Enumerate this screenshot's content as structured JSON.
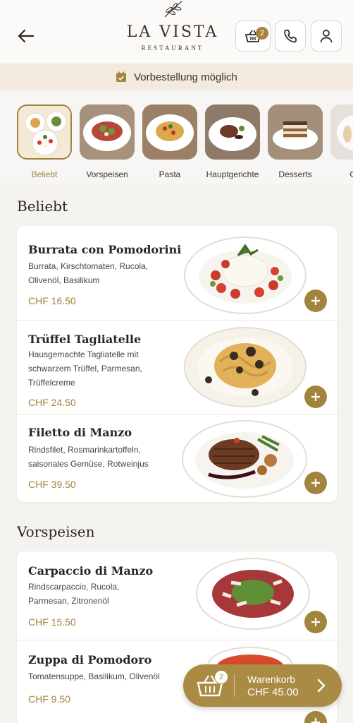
{
  "header": {
    "logo_title": "LA VISTA",
    "logo_subtitle": "RESTAURANT",
    "cart_count": "2"
  },
  "banner": {
    "text": "Vorbestellung möglich"
  },
  "categories": [
    {
      "label": "Beliebt",
      "active": true
    },
    {
      "label": "Vorspeisen"
    },
    {
      "label": "Pasta"
    },
    {
      "label": "Hauptgerichte"
    },
    {
      "label": "Desserts"
    },
    {
      "label": "Getr"
    }
  ],
  "sections": {
    "popular": {
      "title": "Beliebt",
      "items": [
        {
          "name": "Burrata con Pomodorini",
          "desc": "Burrata, Kirschtomaten, Rucola, Olivenöl, Basilikum",
          "price": "CHF 16.50"
        },
        {
          "name": "Trüffel Tagliatelle",
          "desc": "Hausgemachte Tagliatelle mit schwarzem Trüffel, Parmesan, Trüffelcreme",
          "price": "CHF 24.50"
        },
        {
          "name": "Filetto di Manzo",
          "desc": "Rindsfilet, Rosmarinkartoffeln, saisonales Gemüse, Rotweinjus",
          "price": "CHF 39.50"
        }
      ]
    },
    "starters": {
      "title": "Vorspeisen",
      "items": [
        {
          "name": "Carpaccio di Manzo",
          "desc": "Rindscarpaccio, Rucola, Parmesan, Zitronenöl",
          "price": "CHF 15.50"
        },
        {
          "name": "Zuppa di Pomodoro",
          "desc": "Tomatensuppe, Basilikum, Olivenöl",
          "price": "CHF 9.50"
        }
      ]
    }
  },
  "floating_cart": {
    "label": "Warenkorb",
    "total": "CHF 45.00",
    "count": "2"
  },
  "colors": {
    "accent": "#a3843d",
    "banner": "#f2eadc",
    "background": "#f5f3f0"
  }
}
